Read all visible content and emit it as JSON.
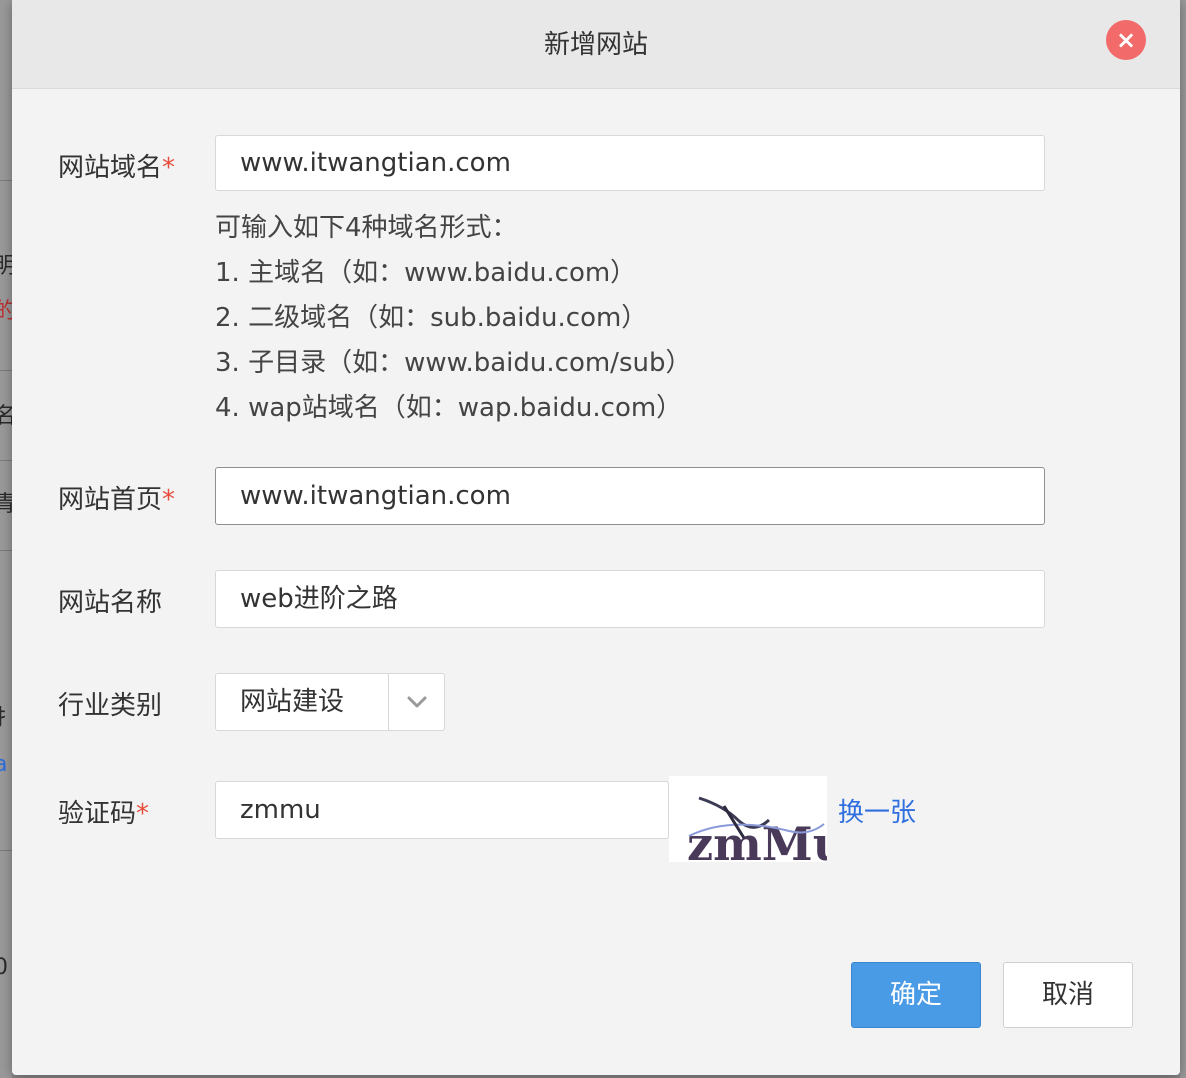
{
  "dialog": {
    "title": "新增网站",
    "close_label": "×"
  },
  "form": {
    "domain": {
      "label": "网站域名",
      "required_mark": "*",
      "value": "www.itwangtian.com"
    },
    "hint": {
      "intro": "可输入如下4种域名形式：",
      "items": [
        "1. 主域名（如：www.baidu.com）",
        "2. 二级域名（如：sub.baidu.com）",
        "3. 子目录（如：www.baidu.com/sub）",
        "4. wap站域名（如：wap.baidu.com）"
      ]
    },
    "homepage": {
      "label": "网站首页",
      "required_mark": "*",
      "value": "www.itwangtian.com"
    },
    "site_name": {
      "label": "网站名称",
      "value": "web进阶之路"
    },
    "category": {
      "label": "行业类别",
      "selected": "网站建设",
      "icon": "chevron-down-icon"
    },
    "captcha": {
      "label": "验证码",
      "required_mark": "*",
      "value": "zmmu",
      "image_text": "zmMu",
      "refresh_label": "换一张"
    }
  },
  "actions": {
    "ok_label": "确定",
    "cancel_label": "取消"
  },
  "background_fragments": [
    "明",
    "的",
    "名",
    "青",
    "扌",
    "a",
    "0"
  ],
  "colors": {
    "primary_button": "#4a9be6",
    "required": "#e74c3c",
    "link": "#2f6fe0",
    "close_button": "#f26a6a"
  }
}
